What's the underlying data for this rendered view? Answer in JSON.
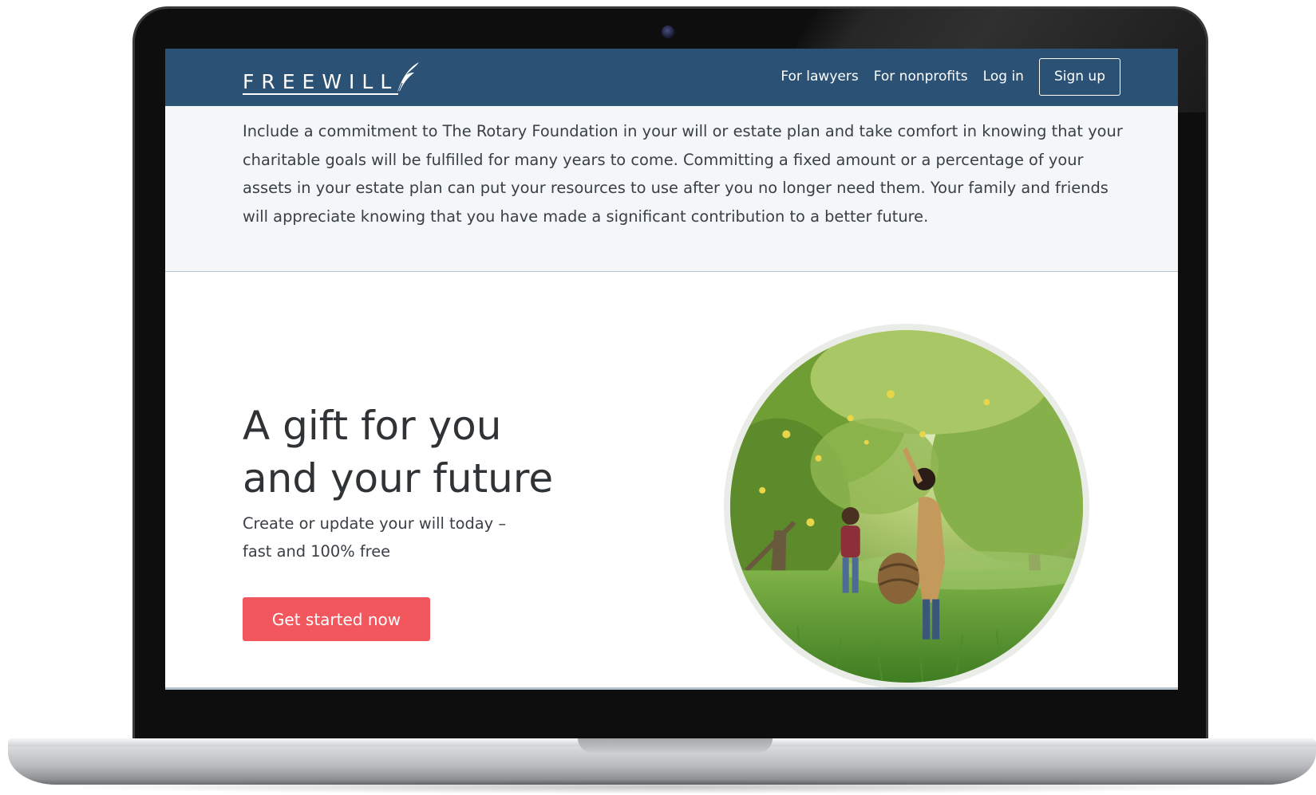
{
  "nav": {
    "logo": "FREEWILL",
    "links": [
      "For lawyers",
      "For nonprofits",
      "Log in"
    ],
    "signup": "Sign up"
  },
  "intro": {
    "text": "Include a commitment to The Rotary Foundation in your will or estate plan and take comfort in knowing that your charitable goals will be fulfilled for many years to come. Committing a fixed amount or a percentage of your assets in your estate plan can put your resources to use after you no longer need them. Your family and friends will appreciate knowing that you have made a significant contribution to a better future."
  },
  "hero": {
    "title_line1": "A gift for you",
    "title_line2": "and your future",
    "subtitle": "Create or update your will today – fast and 100% free",
    "cta": "Get started now"
  },
  "colors": {
    "navbar": "#2b5174",
    "intro_bg": "#f4f7fa",
    "cta": "#f2575e",
    "text": "#2f3336"
  }
}
